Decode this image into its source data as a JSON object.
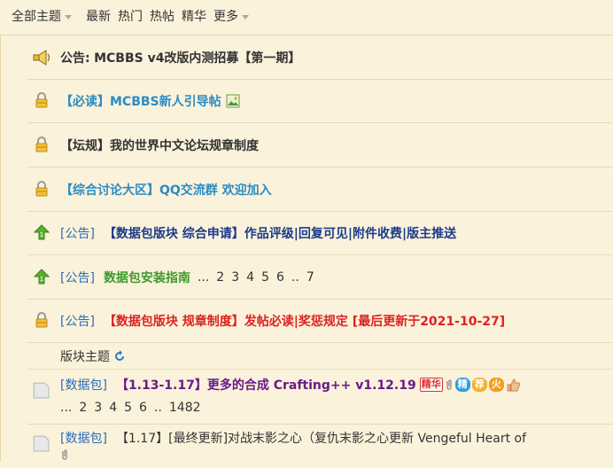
{
  "topbar": {
    "all_topics": "全部主题",
    "latest": "最新",
    "hot": "热门",
    "popular": "热帖",
    "essence": "精华",
    "more": "更多"
  },
  "rows": {
    "announce": {
      "prefix": "公告:",
      "title": "MCBBS v4改版内测招募【第一期】"
    },
    "must_read": {
      "title": "【必读】MCBBS新人引导帖"
    },
    "rules": {
      "title": "【坛规】我的世界中文论坛规章制度"
    },
    "discuss": {
      "title": "【综合讨论大区】QQ交流群 欢迎加入"
    },
    "apply": {
      "tag": "[公告]",
      "title": "【数据包版块 综合申请】作品评级|回复可见|附件收费|版主推送"
    },
    "guide": {
      "tag": "[公告]",
      "title": "数据包安装指南",
      "pages": [
        "...",
        "2",
        "3",
        "4",
        "5",
        "6",
        "..",
        "7"
      ]
    },
    "board_rules": {
      "tag": "[公告]",
      "title": "【数据包版块 规章制度】发帖必读|奖惩规定 [最后更新于2021-10-27]"
    },
    "section_label": "版块主题",
    "crafting": {
      "tag": "[数据包]",
      "title": "【1.13-1.17】更多的合成 Crafting++ v1.12.19",
      "badges": [
        "精华",
        "精",
        "荐",
        "火"
      ],
      "pages": [
        "...",
        "2",
        "3",
        "4",
        "5",
        "6",
        "..",
        "1482"
      ]
    },
    "vengeful": {
      "tag": "[数据包]",
      "title": "【1.17】[最终更新]对战末影之心（复仇末影之心更新 Vengeful Heart of"
    }
  }
}
